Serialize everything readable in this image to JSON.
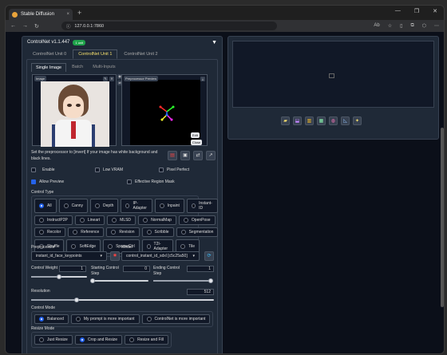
{
  "browser": {
    "tab_title": "Stable Diffusion",
    "tab_close": "×",
    "new_tab": "+",
    "url": "127.0.0.1:7860",
    "zoom_indicator": "Ab",
    "window_controls": [
      "—",
      "❐",
      "✕"
    ]
  },
  "controlnet": {
    "title": "ControlNet v1.1.447",
    "badge": "1 unit",
    "collapse_icon": "▼",
    "units": [
      "ControlNet Unit 0",
      "ControlNet Unit 1",
      "ControlNet Unit 2"
    ],
    "input_tabs": [
      "Single Image",
      "Batch",
      "Multi-Inputs"
    ],
    "image_label": "Image",
    "preview_label": "Preprocessor Preview",
    "preview_edit": "Edit",
    "preview_close": "Close",
    "description": "Set the preprocessor to [invert] If your image has white background and black lines.",
    "checkboxes": {
      "enable": "Enable",
      "low_vram": "Low VRAM",
      "pixel_perfect": "Pixel Perfect",
      "allow_preview": "Allow Preview",
      "effective_region_mask": "Effective Region Mask"
    },
    "control_type_label": "Control Type",
    "control_types": [
      [
        "All",
        "Canny",
        "Depth",
        "IP-Adapter",
        "Inpaint",
        "Instant-ID"
      ],
      [
        "InstructP2P",
        "Lineart",
        "MLSD",
        "NormalMap",
        "OpenPose"
      ],
      [
        "Recolor",
        "Reference",
        "Revision",
        "Scribble",
        "Segmentation"
      ],
      [
        "Shuffle",
        "SoftEdge",
        "SparseCtrl",
        "T2I-Adapter",
        "Tile"
      ]
    ],
    "selected_control_type": "All",
    "preprocessor_label": "Preprocessor",
    "preprocessor_value": "instant_id_face_keypoints",
    "model_label": "Model",
    "model_value": "control_instant_id_sdxl [c5c25a50]",
    "control_weight_label": "Control Weight",
    "control_weight": "1",
    "control_weight_fraction": 0.5,
    "start_step_label": "Starting Control Step",
    "start_step": "0",
    "start_step_fraction": 0.0,
    "end_step_label": "Ending Control Step",
    "end_step": "1",
    "end_step_fraction": 1.0,
    "resolution_label": "Resolution",
    "resolution": "512",
    "resolution_fraction": 0.25,
    "control_mode_label": "Control Mode",
    "control_modes": [
      "Balanced",
      "My prompt is more important",
      "ControlNet is more important"
    ],
    "resize_mode_label": "Resize Mode",
    "resize_modes": [
      "Just Resize",
      "Crop and Resize",
      "Resize and Fill"
    ]
  },
  "colors": {
    "accent": "#2563eb",
    "badge": "#1fa34a",
    "tab_active": "#f7e06e"
  }
}
